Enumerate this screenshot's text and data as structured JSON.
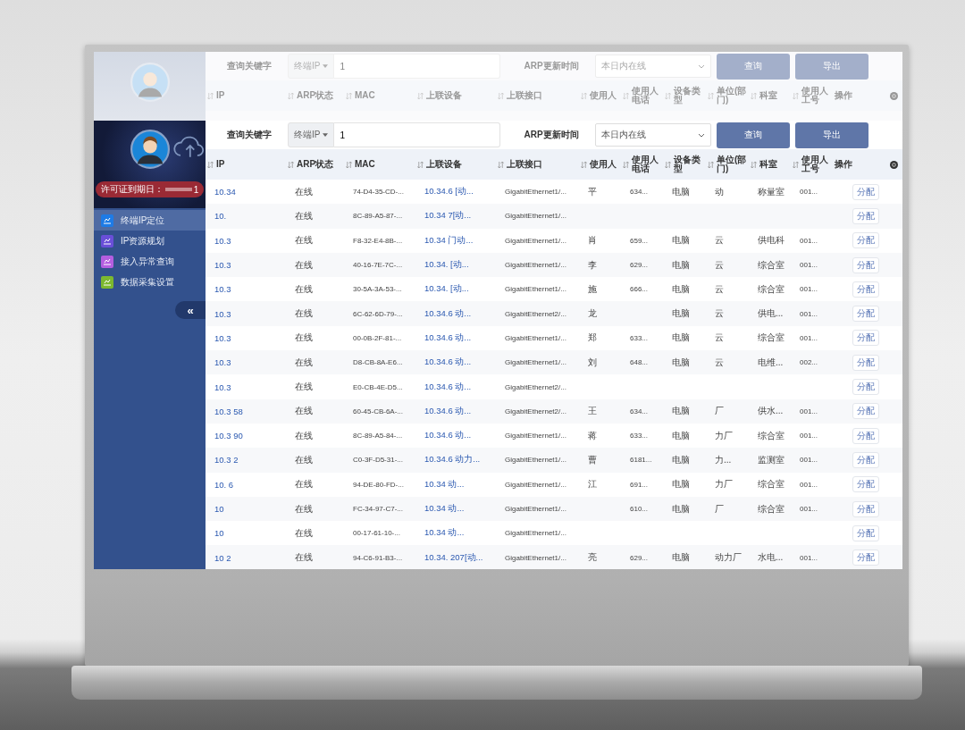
{
  "reflection": {
    "search": {
      "keyword_label": "查询关键字",
      "mode": "终端IP",
      "value": "1",
      "time_label": "ARP更新时间",
      "time_value": "本日内在线",
      "buttons": [
        "查询",
        "导出"
      ]
    },
    "columns": [
      {
        "label": "IP",
        "sortable": true
      },
      {
        "label": "ARP状态",
        "sortable": true
      },
      {
        "label": "MAC",
        "sortable": true
      },
      {
        "label": "上联设备",
        "sortable": true
      },
      {
        "label": "上联接口",
        "sortable": true
      },
      {
        "label": "使用人",
        "sortable": true
      },
      {
        "label": "使用人电话",
        "sortable": true
      },
      {
        "label": "设备类型",
        "sortable": true
      },
      {
        "label": "单位(部门)",
        "sortable": true
      },
      {
        "label": "科室",
        "sortable": true
      },
      {
        "label": "使用人工号",
        "sortable": true
      },
      {
        "label": "操作",
        "sortable": false
      }
    ]
  },
  "sidebar": {
    "license_label": "许可证到期日：",
    "license_tail": "1",
    "menu": [
      {
        "label": "终端IP定位",
        "selected": true,
        "color": "#1e7be6"
      },
      {
        "label": "IP资源规划",
        "selected": false,
        "color": "#6a4fd8"
      },
      {
        "label": "接入异常查询",
        "selected": false,
        "color": "#b45ee0"
      },
      {
        "label": "数据采集设置",
        "selected": false,
        "color": "#7cb82f"
      }
    ],
    "collapse": "«"
  },
  "search": {
    "keyword_label": "查询关键字",
    "mode": "终端IP",
    "value": "1",
    "time_label": "ARP更新时间",
    "time_value": "本日内在线",
    "buttons": [
      "查询",
      "导出"
    ]
  },
  "table": {
    "columns": [
      {
        "label": "IP",
        "sortable": true,
        "kind": "link"
      },
      {
        "label": "ARP状态",
        "sortable": true,
        "kind": "text"
      },
      {
        "label": "MAC",
        "sortable": true,
        "kind": "text"
      },
      {
        "label": "上联设备",
        "sortable": true,
        "kind": "link"
      },
      {
        "label": "上联接口",
        "sortable": true,
        "kind": "text"
      },
      {
        "label": "使用人",
        "sortable": true,
        "kind": "text"
      },
      {
        "label": "使用人电话",
        "sortable": true,
        "kind": "text"
      },
      {
        "label": "设备类型",
        "sortable": true,
        "kind": "text"
      },
      {
        "label": "单位(部门)",
        "sortable": true,
        "kind": "text"
      },
      {
        "label": "科室",
        "sortable": true,
        "kind": "text"
      },
      {
        "label": "使用人工号",
        "sortable": true,
        "kind": "text"
      },
      {
        "label": "操作",
        "sortable": false,
        "kind": "action"
      }
    ],
    "rows": [
      {
        "cells": [
          "10.34",
          "在线",
          "74-D4-35-CD-...",
          "10.34.6 [动...",
          "GigabitEthernet1/...",
          "平",
          "634...",
          "电脑",
          "动",
          "称量室",
          "001...",
          "分配"
        ]
      },
      {
        "cells": [
          "10.",
          "在线",
          "8C-89-A5-87-...",
          "10.34 7[动...",
          "GigabitEthernet1/...",
          "",
          "",
          "",
          "",
          "",
          "",
          "分配"
        ]
      },
      {
        "cells": [
          "10.3",
          "在线",
          "F8-32-E4-8B-...",
          "10.34 门动...",
          "GigabitEthernet1/...",
          "肖",
          "659...",
          "电脑",
          "云",
          "供电科",
          "001...",
          "分配"
        ]
      },
      {
        "cells": [
          "10.3",
          "在线",
          "40-16-7E-7C-...",
          "10.34. [动...",
          "GigabitEthernet1/...",
          "李",
          "629...",
          "电脑",
          "云",
          "综合室",
          "001...",
          "分配"
        ]
      },
      {
        "cells": [
          "10.3",
          "在线",
          "30-5A-3A-53-...",
          "10.34. [动...",
          "GigabitEthernet1/...",
          "施",
          "666...",
          "电脑",
          "云",
          "综合室",
          "001...",
          "分配"
        ]
      },
      {
        "cells": [
          "10.3",
          "在线",
          "6C-62-6D-79-...",
          "10.34.6 动...",
          "GigabitEthernet2/...",
          "龙",
          "",
          "电脑",
          "云",
          "供电...",
          "001...",
          "分配"
        ]
      },
      {
        "cells": [
          "10.3",
          "在线",
          "00-0B-2F-81-...",
          "10.34.6 动...",
          "GigabitEthernet1/...",
          "郑",
          "633...",
          "电脑",
          "云",
          "综合室",
          "001...",
          "分配"
        ]
      },
      {
        "cells": [
          "10.3",
          "在线",
          "D8-CB-8A-E6...",
          "10.34.6 动...",
          "GigabitEthernet1/...",
          "刘",
          "648...",
          "电脑",
          "云",
          "电维...",
          "002...",
          "分配"
        ]
      },
      {
        "cells": [
          "10.3",
          "在线",
          "E0-CB-4E-D5...",
          "10.34.6 动...",
          "GigabitEthernet2/...",
          "",
          "",
          "",
          "",
          "",
          "",
          "分配"
        ]
      },
      {
        "cells": [
          "10.3 58",
          "在线",
          "60-45-CB-6A-...",
          "10.34.6 动...",
          "GigabitEthernet2/...",
          "王",
          "634...",
          "电脑",
          "厂",
          "供水...",
          "001...",
          "分配"
        ]
      },
      {
        "cells": [
          "10.3 90",
          "在线",
          "8C-89-A5-84-...",
          "10.34.6 动...",
          "GigabitEthernet1/...",
          "蒋",
          "633...",
          "电脑",
          "力厂",
          "综合室",
          "001...",
          "分配"
        ]
      },
      {
        "cells": [
          "10.3 2",
          "在线",
          "C0-3F-D5-31-...",
          "10.34.6 动力...",
          "GigabitEthernet1/...",
          "曹",
          "6181...",
          "电脑",
          "力...",
          "监测室",
          "001...",
          "分配"
        ]
      },
      {
        "cells": [
          "10. 6",
          "在线",
          "94-DE-80-FD-...",
          "10.34 动...",
          "GigabitEthernet1/...",
          "江",
          "691...",
          "电脑",
          "力厂",
          "综合室",
          "001...",
          "分配"
        ]
      },
      {
        "cells": [
          "10",
          "在线",
          "FC-34-97-C7-...",
          "10.34 动...",
          "GigabitEthernet1/...",
          "",
          "610...",
          "电脑",
          "厂",
          "综合室",
          "001...",
          "分配"
        ]
      },
      {
        "cells": [
          "10",
          "在线",
          "00-17-61-10-...",
          "10.34 动...",
          "GigabitEthernet1/...",
          "",
          "",
          "",
          "",
          "",
          "",
          "分配"
        ]
      },
      {
        "cells": [
          "10 2",
          "在线",
          "94-C6-91-B3-...",
          "10.34. 207[动...",
          "GigabitEthernet1/...",
          "亮",
          "629...",
          "电脑",
          "动力厂",
          "水电...",
          "001...",
          "分配"
        ]
      }
    ]
  }
}
